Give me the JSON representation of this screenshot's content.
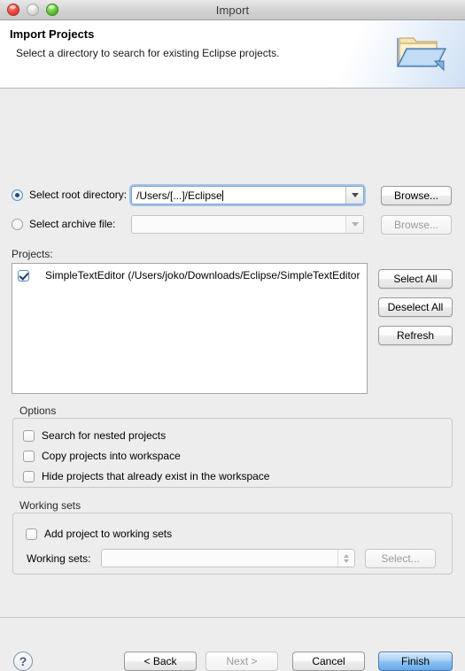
{
  "window": {
    "title": "Import",
    "traffic_lights": [
      "close-button",
      "minimize-button",
      "zoom-button"
    ]
  },
  "header": {
    "title": "Import Projects",
    "description": "Select a directory to search for existing Eclipse projects.",
    "icon": "import-folder-icon"
  },
  "source": {
    "root_directory": {
      "radio_label": "Select root directory:",
      "selected": true,
      "value": "/Users/[...]/Eclipse",
      "browse_label": "Browse...",
      "browse_enabled": true
    },
    "archive_file": {
      "radio_label": "Select archive file:",
      "selected": false,
      "value": "",
      "browse_label": "Browse...",
      "browse_enabled": false
    }
  },
  "projects": {
    "label": "Projects:",
    "items": [
      {
        "checked": true,
        "label": "SimpleTextEditor (/Users/joko/Downloads/Eclipse/SimpleTextEditor"
      }
    ],
    "buttons": {
      "select_all": "Select All",
      "deselect_all": "Deselect All",
      "refresh": "Refresh"
    }
  },
  "options": {
    "group_title": "Options",
    "items": [
      {
        "label": "Search for nested projects",
        "checked": false
      },
      {
        "label": "Copy projects into workspace",
        "checked": false
      },
      {
        "label": "Hide projects that already exist in the workspace",
        "checked": false
      }
    ]
  },
  "working_sets": {
    "group_title": "Working sets",
    "add_checkbox": {
      "label": "Add project to working sets",
      "checked": false
    },
    "field_label": "Working sets:",
    "value": "",
    "select_label": "Select...",
    "select_enabled": false
  },
  "footer": {
    "help_label": "?",
    "back_label": "< Back",
    "next_label": "Next >",
    "next_enabled": false,
    "cancel_label": "Cancel",
    "finish_label": "Finish"
  },
  "colors": {
    "accent": "#66a9e8",
    "window_bg": "#ededed",
    "focus_ring": "#6aa0dc"
  }
}
